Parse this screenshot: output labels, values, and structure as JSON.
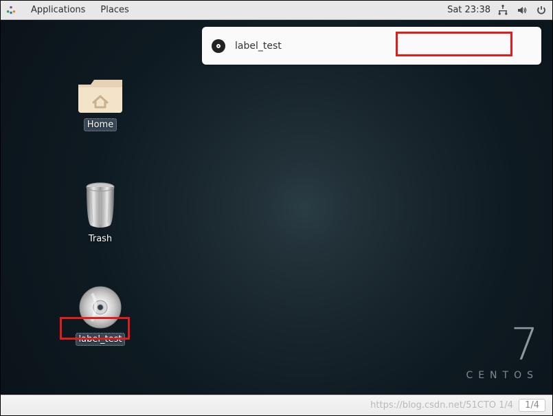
{
  "topbar": {
    "menu_applications": "Applications",
    "menu_places": "Places",
    "clock": "Sat 23:38"
  },
  "desktop": {
    "icons": {
      "home": {
        "label": "Home"
      },
      "trash": {
        "label": "Trash"
      },
      "disc": {
        "label": "label_test"
      }
    }
  },
  "notification": {
    "label": "label_test"
  },
  "brand": {
    "version": "7",
    "name": "CENTOS"
  },
  "footer": {
    "watermark": "https://blog.csdn.net/51CTO 1/4",
    "page": "1/4"
  }
}
